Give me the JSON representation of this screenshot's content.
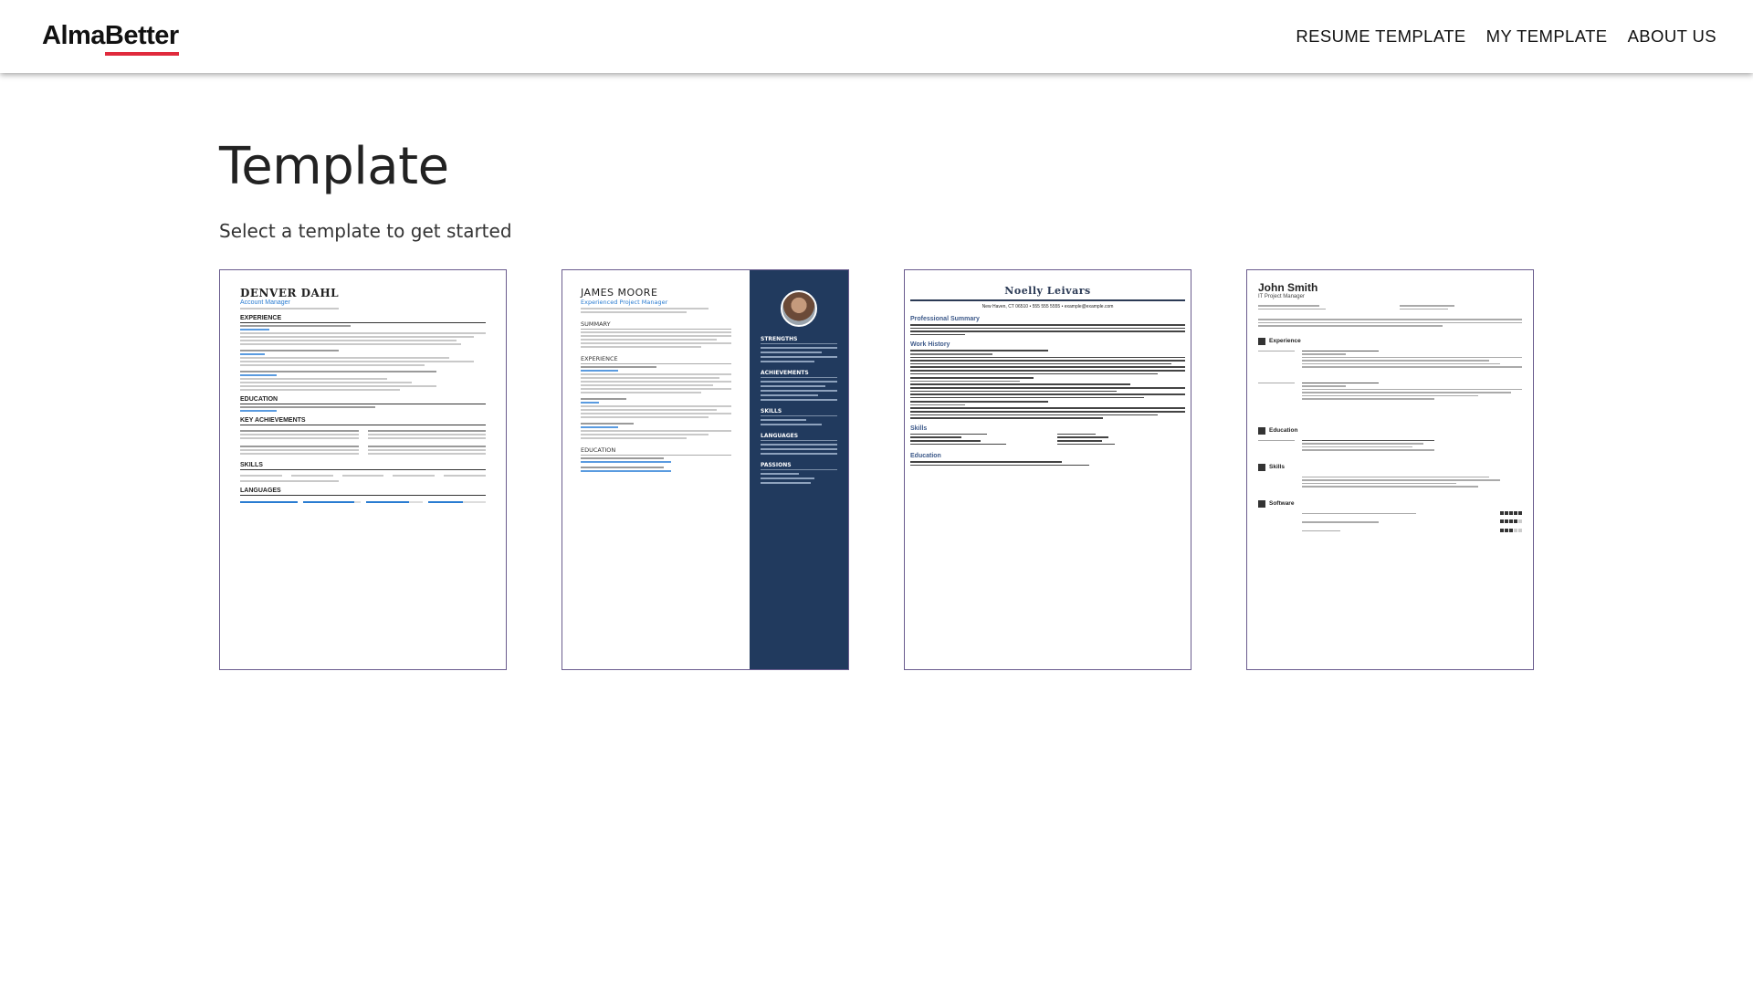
{
  "brand": {
    "logo_part1": "Alma",
    "logo_part2": "Better",
    "accent": "#e02a3c"
  },
  "nav": {
    "items": [
      {
        "label": "RESUME TEMPLATE"
      },
      {
        "label": "MY TEMPLATE"
      },
      {
        "label": "ABOUT US"
      }
    ]
  },
  "page": {
    "title": "Template",
    "subtitle": "Select a template to get started"
  },
  "templates": [
    {
      "name": "DENVER DAHL",
      "role": "Account Manager",
      "sections": [
        "EXPERIENCE",
        "EDUCATION",
        "KEY ACHIEVEMENTS",
        "SKILLS",
        "LANGUAGES"
      ]
    },
    {
      "name": "JAMES MOORE",
      "role": "Experienced Project Manager",
      "sections": [
        "SUMMARY",
        "EXPERIENCE",
        "EDUCATION"
      ],
      "side_sections": [
        "STRENGTHS",
        "ACHIEVEMENTS",
        "SKILLS",
        "LANGUAGES",
        "PASSIONS"
      ],
      "sidebar_color": "#213a5e"
    },
    {
      "name": "Noelly Leivars",
      "contact": "New Haven, CT 06510 • 555 555 5555 • example@example.com",
      "sections": [
        "Professional Summary",
        "Work History",
        "Skills",
        "Education"
      ]
    },
    {
      "name": "John Smith",
      "role": "IT Project Manager",
      "sections": [
        "Experience",
        "Education",
        "Skills",
        "Software"
      ]
    }
  ]
}
